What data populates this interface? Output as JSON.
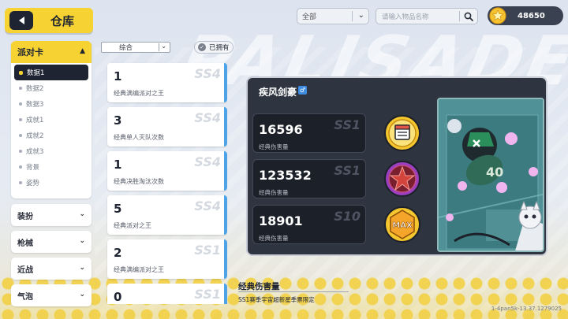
{
  "header": {
    "title": "仓库",
    "filter_value": "全部",
    "search_placeholder": "请输入物品名称",
    "currency_amount": "48650"
  },
  "sidebar": {
    "group": {
      "label": "派对卡",
      "items": [
        "数据1",
        "数据2",
        "数据3",
        "成就1",
        "成就2",
        "成就3",
        "背景",
        "姿势"
      ],
      "active_index": 0
    },
    "categories": [
      "装扮",
      "枪械",
      "近战",
      "气泡"
    ]
  },
  "toolbar": {
    "sort_value": "综合",
    "owned_label": "已拥有"
  },
  "records": [
    {
      "value": "1",
      "season": "SS4",
      "desc": "经典满编派对之王"
    },
    {
      "value": "3",
      "season": "SS4",
      "desc": "经典单人灭队次数"
    },
    {
      "value": "1",
      "season": "SS4",
      "desc": "经典决胜淘汰次数"
    },
    {
      "value": "5",
      "season": "SS4",
      "desc": "经典派对之王"
    },
    {
      "value": "2",
      "season": "SS1",
      "desc": "经典满编派对之王"
    },
    {
      "value": "0",
      "season": "SS1",
      "desc": ""
    }
  ],
  "detail": {
    "player_name": "疾风剑豪",
    "gender_symbol": "♂",
    "stats": [
      {
        "value": "16596",
        "season": "SS1",
        "label": "经典伤害量"
      },
      {
        "value": "123532",
        "season": "SS1",
        "label": "经典伤害量"
      },
      {
        "value": "18901",
        "season": "S10",
        "label": "经典伤害量"
      }
    ],
    "badge_max_text": "MAX",
    "card_number": "40"
  },
  "bottom": {
    "title": "经典伤害量",
    "description": "SS1赛季宇宙超新星季票限定"
  },
  "build": "1-4pan5k-13.37.1279025",
  "watermark": "PALISADE",
  "colors": {
    "accent_yellow": "#f6d232",
    "dark": "#1e2432",
    "record_stripe": "#4ea3e6",
    "panel_bg": "#2e3440"
  }
}
